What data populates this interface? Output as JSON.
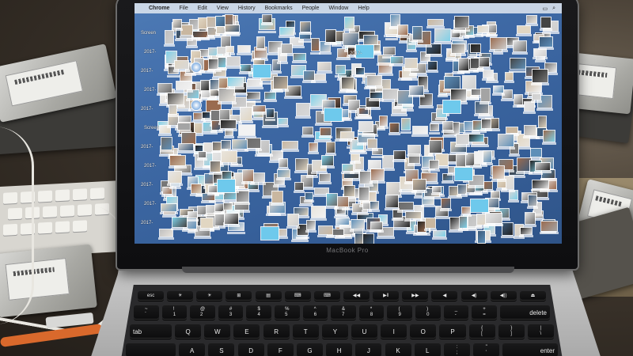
{
  "menubar": {
    "apple": "",
    "app": "Chrome",
    "items": [
      "File",
      "Edit",
      "View",
      "History",
      "Bookmarks",
      "People",
      "Window",
      "Help"
    ]
  },
  "screen": {
    "left_labels": [
      "Screen",
      "2017-",
      "2017-",
      "2017-",
      "2017-",
      "Screen",
      "2017-",
      "2017-",
      "2017-",
      "2017-",
      "2017-"
    ],
    "desktop_label": "2017-"
  },
  "brand": "MacBook Pro",
  "keyboard": {
    "row0": [
      "esc",
      "☀",
      "☀",
      "⊞",
      "▤",
      "⌨",
      "⌨",
      "◀◀",
      "▶‖",
      "▶▶",
      "◀",
      "◀)",
      "◀))",
      "⏏"
    ],
    "row1": [
      "~\n`",
      "!\n1",
      "@\n2",
      "#\n3",
      "$\n4",
      "%\n5",
      "^\n6",
      "&\n7",
      "*\n8",
      "(\n9",
      ")\n0",
      "_\n-",
      "+\n=",
      "delete"
    ],
    "row2": [
      "tab",
      "Q",
      "W",
      "E",
      "R",
      "T",
      "Y",
      "U",
      "I",
      "O",
      "P",
      "{\n[",
      "}\n]",
      "|\n\\"
    ],
    "row3": [
      "",
      "A",
      "S",
      "D",
      "F",
      "G",
      "H",
      "J",
      "K",
      "L",
      ":\n;",
      "\"\n'",
      "enter"
    ]
  },
  "colors": {
    "desktop": "#3f6aa6",
    "bezel": "#111113",
    "aluminum": "#b8b8b8",
    "keys": "#131314"
  }
}
